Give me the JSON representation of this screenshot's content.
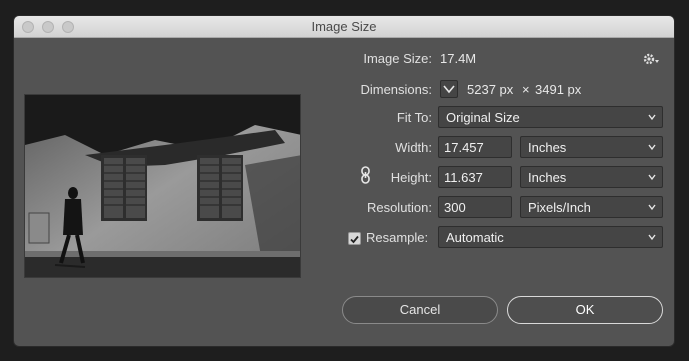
{
  "window": {
    "title": "Image Size"
  },
  "info": {
    "image_size_label": "Image Size:",
    "image_size_value": "17.4M",
    "dimensions_label": "Dimensions:",
    "dim_width": "5237 px",
    "dim_times": "×",
    "dim_height": "3491 px"
  },
  "fit_to": {
    "label": "Fit To:",
    "value": "Original Size"
  },
  "width": {
    "label": "Width:",
    "value": "17.457",
    "unit": "Inches"
  },
  "height": {
    "label": "Height:",
    "value": "11.637",
    "unit": "Inches"
  },
  "resolution": {
    "label": "Resolution:",
    "value": "300",
    "unit": "Pixels/Inch"
  },
  "resample": {
    "label": "Resample:",
    "value": "Automatic",
    "checked": true
  },
  "buttons": {
    "cancel": "Cancel",
    "ok": "OK"
  },
  "icons": {
    "settings": "gear-icon",
    "constrain": "link-icon",
    "dimensions_toggle": "chevron-down-icon",
    "checkbox": "checkmark-icon"
  }
}
